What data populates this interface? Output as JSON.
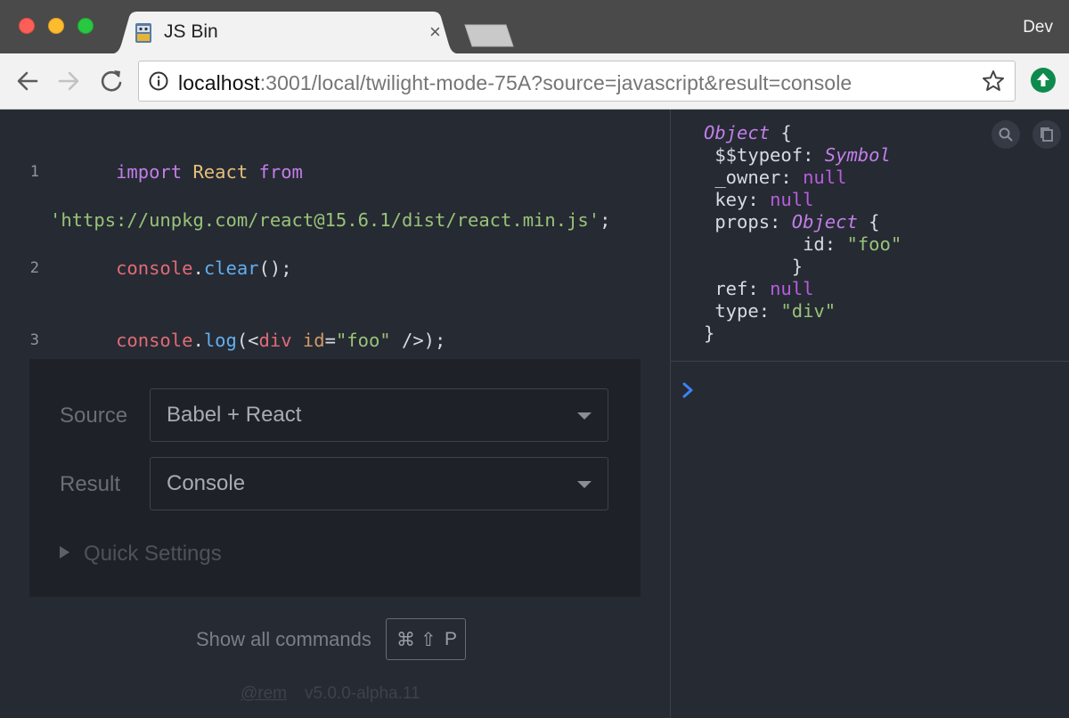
{
  "browser": {
    "tab_title": "JS Bin",
    "tab_close": "×",
    "profile": "Dev",
    "url_host": "localhost",
    "url_rest": ":3001/local/twilight-mode-75A?source=javascript&result=console"
  },
  "editor": {
    "lines": [
      {
        "number": "1",
        "text": "import React from 'https://unpkg.com/react@15.6.1/dist/react.min.js';"
      },
      {
        "number": "2",
        "text": "console.clear();"
      },
      {
        "number": "3",
        "text": "console.log(<div id=\"foo\" />);"
      }
    ]
  },
  "settings": {
    "source_label": "Source",
    "source_value": "Babel + React",
    "result_label": "Result",
    "result_value": "Console",
    "quick_settings": "Quick Settings"
  },
  "commands": {
    "show_all": "Show all commands",
    "shortcut_cmd": "⌘",
    "shortcut_shift": "⇧",
    "shortcut_key": "P"
  },
  "footer": {
    "user": "@rem",
    "version": "v5.0.0-alpha.11"
  },
  "console": {
    "output": [
      {
        "parts": [
          {
            "cls": "t",
            "text": "Object"
          },
          {
            "cls": "k",
            "text": " {"
          }
        ]
      },
      {
        "parts": [
          {
            "cls": "k",
            "text": " $$typeof: "
          },
          {
            "cls": "t",
            "text": "Symbol"
          }
        ]
      },
      {
        "parts": [
          {
            "cls": "k",
            "text": " _owner: "
          },
          {
            "cls": "n",
            "text": "null"
          }
        ]
      },
      {
        "parts": [
          {
            "cls": "k",
            "text": " key: "
          },
          {
            "cls": "n",
            "text": "null"
          }
        ]
      },
      {
        "parts": [
          {
            "cls": "k",
            "text": " props: "
          },
          {
            "cls": "t",
            "text": "Object"
          },
          {
            "cls": "k",
            "text": " {"
          }
        ]
      },
      {
        "parts": [
          {
            "cls": "k",
            "text": "         id: "
          },
          {
            "cls": "s",
            "text": "\"foo\""
          }
        ]
      },
      {
        "parts": [
          {
            "cls": "k",
            "text": "        }"
          }
        ]
      },
      {
        "parts": [
          {
            "cls": "k",
            "text": " ref: "
          },
          {
            "cls": "n",
            "text": "null"
          }
        ]
      },
      {
        "parts": [
          {
            "cls": "k",
            "text": " type: "
          },
          {
            "cls": "s",
            "text": "\"div\""
          }
        ]
      },
      {
        "parts": [
          {
            "cls": "k",
            "text": "}"
          }
        ]
      }
    ]
  },
  "colors": {
    "editor_bg": "#262a33",
    "settings_bg": "#1f2128",
    "keyword": "#c17fe8",
    "string": "#98c379",
    "prompt": "#3b82f6"
  },
  "icons": [
    "back-icon",
    "forward-icon",
    "reload-icon",
    "info-icon",
    "star-icon",
    "extension-icon",
    "search-icon",
    "copy-icon",
    "prompt-chevron-icon"
  ]
}
